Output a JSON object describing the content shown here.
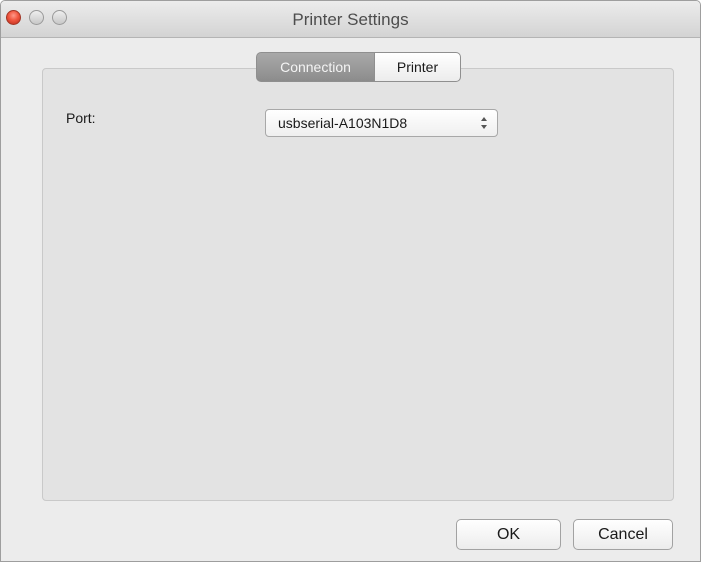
{
  "window": {
    "title": "Printer Settings"
  },
  "tabs": [
    {
      "label": "Connection",
      "selected": true
    },
    {
      "label": "Printer",
      "selected": false
    }
  ],
  "connection": {
    "port_label": "Port:",
    "port_value": "usbserial-A103N1D8"
  },
  "buttons": {
    "ok_label": "OK",
    "cancel_label": "Cancel"
  },
  "colors": {
    "close_button": "#f0563f",
    "selected_tab": "#8c8c8c"
  }
}
